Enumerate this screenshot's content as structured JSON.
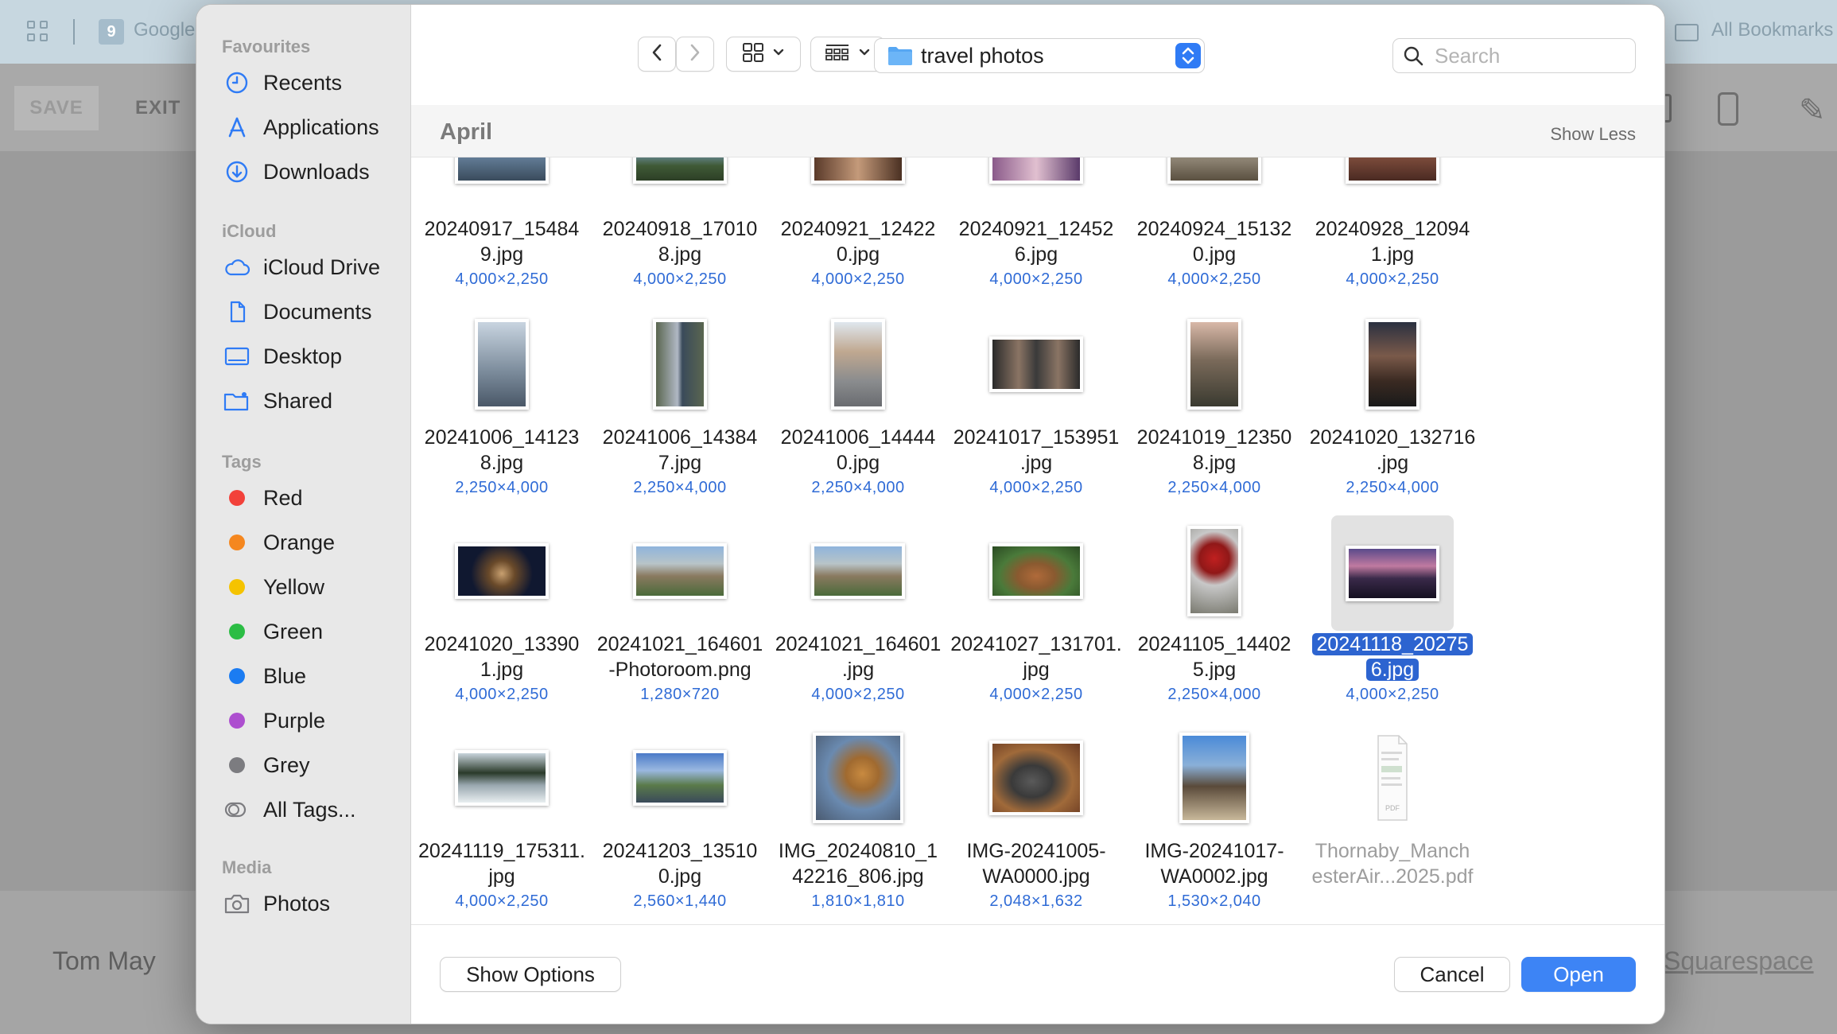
{
  "background": {
    "google_label": "Google",
    "all_bookmarks": "All Bookmarks",
    "save_label": "SAVE",
    "exit_label": "EXIT",
    "author": "Tom May",
    "squarespace": "Squarespace"
  },
  "sidebar": {
    "favourites_title": "Favourites",
    "favourites": [
      {
        "label": "Recents",
        "icon": "clock-icon"
      },
      {
        "label": "Applications",
        "icon": "applications-icon"
      },
      {
        "label": "Downloads",
        "icon": "download-icon"
      }
    ],
    "icloud_title": "iCloud",
    "icloud": [
      {
        "label": "iCloud Drive",
        "icon": "cloud-icon"
      },
      {
        "label": "Documents",
        "icon": "document-icon"
      },
      {
        "label": "Desktop",
        "icon": "desktop-icon"
      },
      {
        "label": "Shared",
        "icon": "shared-folder-icon"
      }
    ],
    "tags_title": "Tags",
    "tags": [
      {
        "label": "Red",
        "color": "#f2413a"
      },
      {
        "label": "Orange",
        "color": "#f5871f"
      },
      {
        "label": "Yellow",
        "color": "#f5c300"
      },
      {
        "label": "Green",
        "color": "#2bbd44"
      },
      {
        "label": "Blue",
        "color": "#1b7cf2"
      },
      {
        "label": "Purple",
        "color": "#ad4fcf"
      },
      {
        "label": "Grey",
        "color": "#7c7c80"
      },
      {
        "label": "All Tags..."
      }
    ],
    "media_title": "Media",
    "media": [
      {
        "label": "Photos",
        "icon": "camera-icon"
      }
    ]
  },
  "toolbar": {
    "path": "travel photos",
    "search_placeholder": "Search"
  },
  "section": {
    "title": "April",
    "show_less": "Show Less"
  },
  "files": [
    {
      "line1": "20240917_15484",
      "line2": "9.jpg",
      "dims": "4,000×2,250"
    },
    {
      "line1": "20240918_17010",
      "line2": "8.jpg",
      "dims": "4,000×2,250"
    },
    {
      "line1": "20240921_12422",
      "line2": "0.jpg",
      "dims": "4,000×2,250"
    },
    {
      "line1": "20240921_12452",
      "line2": "6.jpg",
      "dims": "4,000×2,250"
    },
    {
      "line1": "20240924_15132",
      "line2": "0.jpg",
      "dims": "4,000×2,250"
    },
    {
      "line1": "20240928_12094",
      "line2": "1.jpg",
      "dims": "4,000×2,250"
    },
    {
      "line1": "20241006_14123",
      "line2": "8.jpg",
      "dims": "2,250×4,000"
    },
    {
      "line1": "20241006_14384",
      "line2": "7.jpg",
      "dims": "2,250×4,000"
    },
    {
      "line1": "20241006_14444",
      "line2": "0.jpg",
      "dims": "2,250×4,000"
    },
    {
      "line1": "20241017_153951",
      "line2": ".jpg",
      "dims": "4,000×2,250"
    },
    {
      "line1": "20241019_12350",
      "line2": "8.jpg",
      "dims": "2,250×4,000"
    },
    {
      "line1": "20241020_132716",
      "line2": ".jpg",
      "dims": "2,250×4,000"
    },
    {
      "line1": "20241020_13390",
      "line2": "1.jpg",
      "dims": "4,000×2,250"
    },
    {
      "line1": "20241021_164601",
      "line2": "-Photoroom.png",
      "dims": "1,280×720"
    },
    {
      "line1": "20241021_164601",
      "line2": ".jpg",
      "dims": "4,000×2,250"
    },
    {
      "line1": "20241027_131701.",
      "line2": "jpg",
      "dims": "4,000×2,250"
    },
    {
      "line1": "20241105_14402",
      "line2": "5.jpg",
      "dims": "2,250×4,000"
    },
    {
      "line1": "20241118_20275",
      "line2": "6.jpg",
      "dims": "4,000×2,250",
      "selected": true
    },
    {
      "line1": "20241119_175311.",
      "line2": "jpg",
      "dims": "4,000×2,250"
    },
    {
      "line1": "20241203_13510",
      "line2": "0.jpg",
      "dims": "2,560×1,440"
    },
    {
      "line1": "IMG_20240810_1",
      "line2": "42216_806.jpg",
      "dims": "1,810×1,810"
    },
    {
      "line1": "IMG-20241005-",
      "line2": "WA0000.jpg",
      "dims": "2,048×1,632"
    },
    {
      "line1": "IMG-20241017-",
      "line2": "WA0002.jpg",
      "dims": "1,530×2,040"
    },
    {
      "line1": "Thornaby_Manch",
      "line2": "esterAir...2025.pdf",
      "dims": "",
      "dimmed": true
    }
  ],
  "footer": {
    "show_options": "Show Options",
    "cancel": "Cancel",
    "open": "Open"
  }
}
